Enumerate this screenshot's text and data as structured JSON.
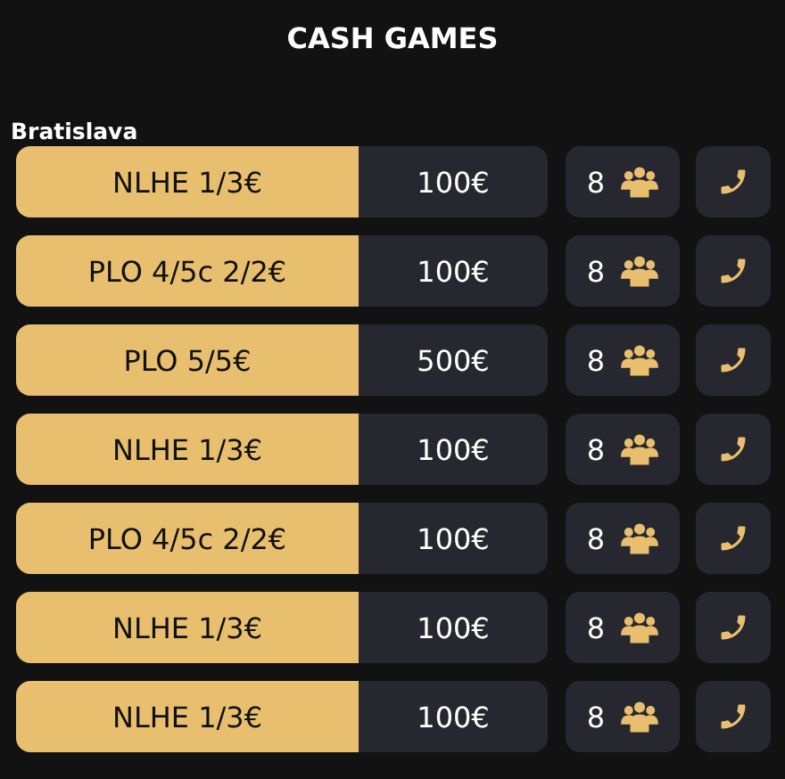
{
  "title": "CASH GAMES",
  "location": "Bratislava",
  "games": [
    {
      "game": "NLHE 1/3€",
      "buyin": "100€",
      "players": "8"
    },
    {
      "game": "PLO 4/5c 2/2€",
      "buyin": "100€",
      "players": "8"
    },
    {
      "game": "PLO 5/5€",
      "buyin": "500€",
      "players": "8"
    },
    {
      "game": "NLHE 1/3€",
      "buyin": "100€",
      "players": "8"
    },
    {
      "game": "PLO 4/5c 2/2€",
      "buyin": "100€",
      "players": "8"
    },
    {
      "game": "NLHE 1/3€",
      "buyin": "100€",
      "players": "8"
    },
    {
      "game": "NLHE 1/3€",
      "buyin": "100€",
      "players": "8"
    }
  ]
}
